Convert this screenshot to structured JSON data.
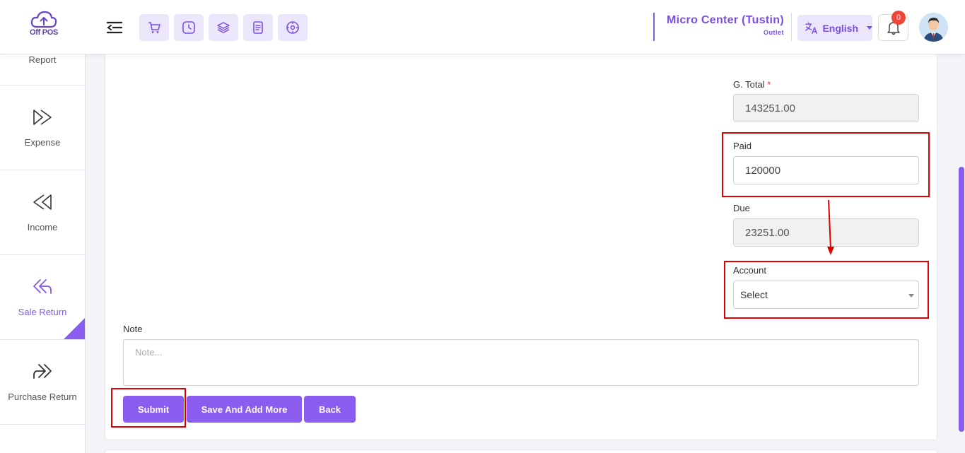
{
  "header": {
    "logo_text": "Off POS",
    "outlet_name": "Micro Center (Tustin)",
    "outlet_sub": "Outlet",
    "language": "English",
    "notifications_count": "0"
  },
  "sidebar": {
    "items": [
      {
        "label": "Report"
      },
      {
        "label": "Expense"
      },
      {
        "label": "Income"
      },
      {
        "label": "Sale Return"
      },
      {
        "label": "Purchase Return"
      }
    ]
  },
  "form": {
    "g_total_label": "G. Total",
    "g_total_required": "*",
    "g_total_value": "143251.00",
    "paid_label": "Paid",
    "paid_value": "120000",
    "due_label": "Due",
    "due_value": "23251.00",
    "account_label": "Account",
    "account_value": "Select",
    "note_label": "Note",
    "note_placeholder": "Note..."
  },
  "buttons": {
    "submit": "Submit",
    "save_add_more": "Save And Add More",
    "back": "Back"
  },
  "colors": {
    "accent": "#8a5cf0",
    "highlight": "#e00000"
  }
}
